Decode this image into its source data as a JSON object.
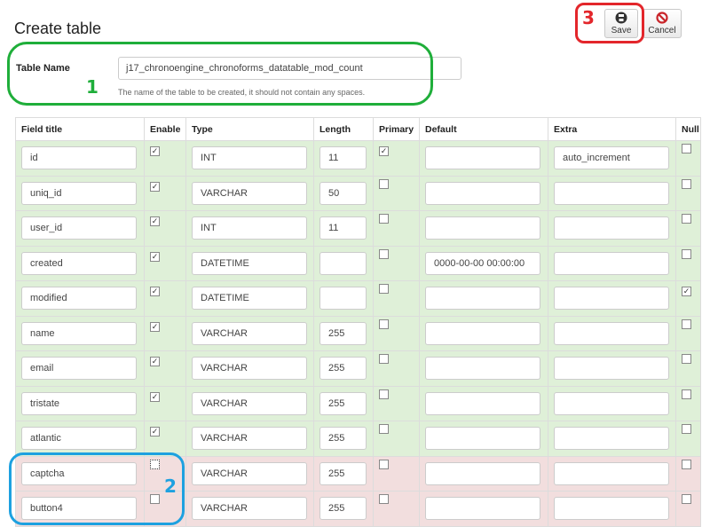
{
  "page": {
    "title": "Create table"
  },
  "toolbar": {
    "save_label": "Save",
    "cancel_label": "Cancel",
    "save_icon": "floppy-disk-icon",
    "cancel_icon": "no-entry-icon"
  },
  "table_name": {
    "label": "Table Name",
    "value": "j17_chronoengine_chronoforms_datatable_mod_count",
    "help": "The name of the table to be created, it should not contain any spaces."
  },
  "annotations": {
    "one": "1",
    "two": "2",
    "three": "3"
  },
  "colors": {
    "callout_green": "#1fae3a",
    "callout_blue": "#1da1e0",
    "callout_red": "#e3262b",
    "row_enabled": "#dff0d8",
    "row_disabled": "#f2dede"
  },
  "columns": {
    "field_title": "Field title",
    "enable": "Enable",
    "type": "Type",
    "length": "Length",
    "primary": "Primary",
    "default": "Default",
    "extra": "Extra",
    "null": "Null"
  },
  "fields": [
    {
      "title": "id",
      "enable": true,
      "type": "INT",
      "length": "11",
      "primary": true,
      "default": "",
      "extra": "auto_increment",
      "null": false
    },
    {
      "title": "uniq_id",
      "enable": true,
      "type": "VARCHAR",
      "length": "50",
      "primary": false,
      "default": "",
      "extra": "",
      "null": false
    },
    {
      "title": "user_id",
      "enable": true,
      "type": "INT",
      "length": "11",
      "primary": false,
      "default": "",
      "extra": "",
      "null": false
    },
    {
      "title": "created",
      "enable": true,
      "type": "DATETIME",
      "length": "",
      "primary": false,
      "default": "0000-00-00 00:00:00",
      "extra": "",
      "null": false
    },
    {
      "title": "modified",
      "enable": true,
      "type": "DATETIME",
      "length": "",
      "primary": false,
      "default": "",
      "extra": "",
      "null": true
    },
    {
      "title": "name",
      "enable": true,
      "type": "VARCHAR",
      "length": "255",
      "primary": false,
      "default": "",
      "extra": "",
      "null": false
    },
    {
      "title": "email",
      "enable": true,
      "type": "VARCHAR",
      "length": "255",
      "primary": false,
      "default": "",
      "extra": "",
      "null": false
    },
    {
      "title": "tristate",
      "enable": true,
      "type": "VARCHAR",
      "length": "255",
      "primary": false,
      "default": "",
      "extra": "",
      "null": false
    },
    {
      "title": "atlantic",
      "enable": true,
      "type": "VARCHAR",
      "length": "255",
      "primary": false,
      "default": "",
      "extra": "",
      "null": false
    },
    {
      "title": "captcha",
      "enable": false,
      "enable_focused": true,
      "type": "VARCHAR",
      "length": "255",
      "primary": false,
      "default": "",
      "extra": "",
      "null": false
    },
    {
      "title": "button4",
      "enable": false,
      "type": "VARCHAR",
      "length": "255",
      "primary": false,
      "default": "",
      "extra": "",
      "null": false
    }
  ]
}
